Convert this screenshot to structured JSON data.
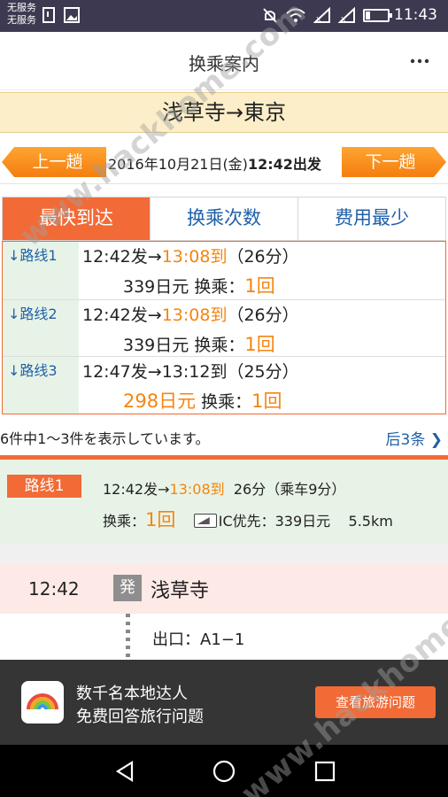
{
  "status_bar": {
    "carrier_line1": "无服务",
    "carrier_line2": "无服务",
    "time": "11:43"
  },
  "header": {
    "title": "换乘案内"
  },
  "route_title": "浅草寺→東京",
  "date_nav": {
    "prev_label": "上一趟",
    "next_label": "下一趟",
    "date": "2016年10月21日(金)",
    "depart": "12:42出发"
  },
  "tabs": [
    {
      "label": "最快到达",
      "active": true
    },
    {
      "label": "换乘次数",
      "active": false
    },
    {
      "label": "费用最少",
      "active": false
    }
  ],
  "routes": [
    {
      "link": "路线1",
      "dep": "12:42发→",
      "arr": "13:08到",
      "dur": "（26分）",
      "fare": "339日元",
      "transfer_label": "换乘：",
      "transfers": "1回"
    },
    {
      "link": "路线2",
      "dep": "12:42发→",
      "arr": "13:08到",
      "dur": "（26分）",
      "fare": "339日元",
      "transfer_label": "换乘：",
      "transfers": "1回"
    },
    {
      "link": "路线3",
      "dep": "12:47发→",
      "arr": "13:12到",
      "dur": "（25分）",
      "fare": "298日元",
      "transfer_label": "换乘：",
      "transfers": "1回"
    }
  ],
  "pager": {
    "summary": "6件中1～3件を表示しています。",
    "next": "后3条"
  },
  "detail": {
    "tag": "路线1",
    "dep": "12:42发→",
    "arr": "13:08到",
    "duration": "26分（乘车9分）",
    "transfer_label": "换乘：",
    "transfers": "1回",
    "ic_fare": "IC优先：339日元",
    "distance": "5.5km"
  },
  "timeline": {
    "time": "12:42",
    "badge": "発",
    "station": "浅草寺",
    "exit": "出口：A1−1"
  },
  "banner": {
    "line1": "数千名本地达人",
    "line2": "免费回答旅行问题",
    "button": "查看旅游问题"
  },
  "watermark": "www.hackhome.com",
  "colors": {
    "accent": "#f26a36",
    "highlight": "#f4850f",
    "link": "#2060a8",
    "status_bar": "#3c3950"
  }
}
